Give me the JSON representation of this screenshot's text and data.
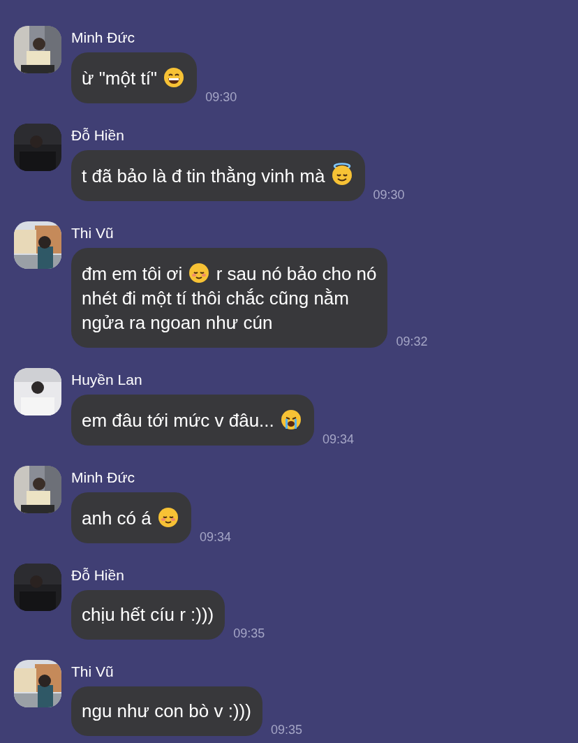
{
  "messages": [
    {
      "sender": "Minh Đức",
      "time": "09:30",
      "lines": [
        [
          {
            "kind": "text",
            "text": "ừ \"một tí\" "
          },
          {
            "kind": "grin"
          }
        ]
      ]
    },
    {
      "sender": "Đỗ Hiền",
      "time": "09:30",
      "lines": [
        [
          {
            "kind": "text",
            "text": "t đã bảo là đ tin thằng vinh mà "
          },
          {
            "kind": "halo"
          }
        ]
      ]
    },
    {
      "sender": "Thi Vũ",
      "time": "09:32",
      "lines": [
        [
          {
            "kind": "text",
            "text": "đm em tôi ơi "
          },
          {
            "kind": "blush"
          },
          {
            "kind": "text",
            "text": " r sau nó bảo cho nó"
          }
        ],
        [
          {
            "kind": "text",
            "text": "nhét đi một tí thôi chắc cũng nằm"
          }
        ],
        [
          {
            "kind": "text",
            "text": "ngửa ra ngoan như cún"
          }
        ]
      ]
    },
    {
      "sender": "Huyền Lan",
      "time": "09:34",
      "lines": [
        [
          {
            "kind": "text",
            "text": "em đâu tới mức v đâu... "
          },
          {
            "kind": "cry"
          }
        ]
      ]
    },
    {
      "sender": "Minh Đức",
      "time": "09:34",
      "lines": [
        [
          {
            "kind": "text",
            "text": "anh có á "
          },
          {
            "kind": "blush"
          }
        ]
      ]
    },
    {
      "sender": "Đỗ Hiền",
      "time": "09:35",
      "lines": [
        [
          {
            "kind": "text",
            "text": "chịu hết cíu r :)))"
          }
        ]
      ]
    },
    {
      "sender": "Thi Vũ",
      "time": "09:35",
      "lines": [
        [
          {
            "kind": "text",
            "text": "ngu như con bò v :)))"
          }
        ]
      ]
    }
  ]
}
